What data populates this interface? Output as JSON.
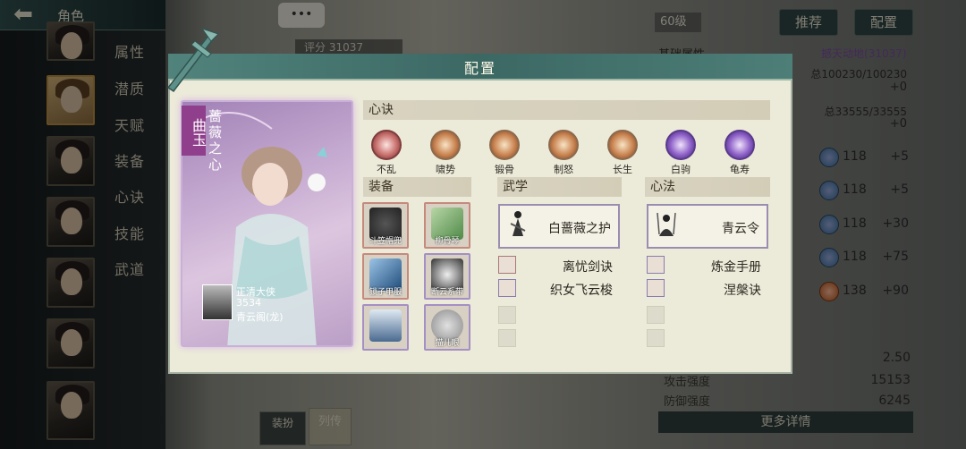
{
  "topbar": {
    "title": "角色",
    "back": "⬅"
  },
  "side_menu": [
    "属性",
    "潜质",
    "天赋",
    "装备",
    "心诀",
    "技能",
    "武道"
  ],
  "chat_bubble": "•••",
  "score_text": "评分 31037",
  "right_panel": {
    "level": "60级",
    "buttons": [
      "推荐",
      "配置"
    ],
    "basic_attr_label": "基础属性",
    "power_text": "撼天动地(31037)",
    "hp_total": "总100230/100230",
    "hp_add": "+0",
    "mp_total": "总33555/33555",
    "mp_add": "+0",
    "stat_rows": [
      {
        "value": "118",
        "add": "+5"
      },
      {
        "value": "118",
        "add": "+5"
      },
      {
        "value": "118",
        "add": "+30"
      },
      {
        "value": "118",
        "add": "+75"
      },
      {
        "value": "138",
        "add": "+90"
      }
    ],
    "bottom_values": [
      "2.50",
      "15153",
      "6245"
    ],
    "bottom_labels": [
      "攻击强度",
      "防御强度"
    ],
    "more_label": "更多详情",
    "bottom_tabs": [
      "装扮",
      "列传"
    ]
  },
  "dialog": {
    "title": "配置",
    "character": {
      "name": "曲玉",
      "title": "蔷薇之心",
      "owner_name": "正清大侠",
      "owner_score": "3534",
      "owner_guild": "青云阁(龙)"
    },
    "xinjue_section": "心诀",
    "xinjue": [
      "不乱",
      "啸势",
      "锻骨",
      "制怒",
      "长生",
      "白驹",
      "龟寿"
    ],
    "equip_section": "装备",
    "equipment": [
      "斗笠帽兜",
      "柳骨琴",
      "锁子甲服",
      "断云系带",
      "",
      "猫儿眼"
    ],
    "wuxue_section": "武学",
    "wuxue_main": "白蔷薇之护",
    "wuxue_list": [
      "离忧剑诀",
      "织女飞云梭"
    ],
    "xinfa_section": "心法",
    "xinfa_main": "青云令",
    "xinfa_list": [
      "炼金手册",
      "涅槃诀"
    ]
  }
}
